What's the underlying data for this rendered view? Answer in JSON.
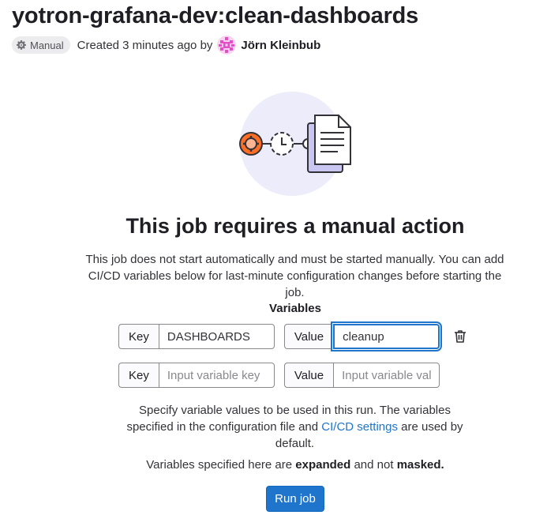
{
  "job": {
    "title": "yotron-grafana-dev:clean-dashboards",
    "status_badge": "Manual",
    "created_text": "Created 3 minutes ago by",
    "author": "Jörn Kleinbub"
  },
  "empty_state": {
    "heading": "This job requires a manual action",
    "description": "This job does not start automatically and must be started manually. You can add CI/CD variables below for last-minute configuration changes before starting the job."
  },
  "variables": {
    "label": "Variables",
    "key_prefix": "Key",
    "value_prefix": "Value",
    "rows": [
      {
        "key": "DASHBOARDS",
        "value": "cleanup"
      },
      {
        "key": "",
        "value": "",
        "key_placeholder": "Input variable key",
        "value_placeholder": "Input variable value"
      }
    ]
  },
  "help": {
    "text_before": "Specify variable values to be used in this run. The variables specified in the configuration file and ",
    "link": "CI/CD settings",
    "text_after": " are used by default."
  },
  "note": {
    "prefix": "Variables specified here are ",
    "expanded": "expanded",
    "middle": " and not ",
    "masked": "masked."
  },
  "actions": {
    "run_label": "Run job"
  },
  "colors": {
    "primary": "#1f75cb",
    "illustration_circle": "#ececfa",
    "gear_accent": "#fc6d26",
    "avatar": "#e24fc7"
  }
}
